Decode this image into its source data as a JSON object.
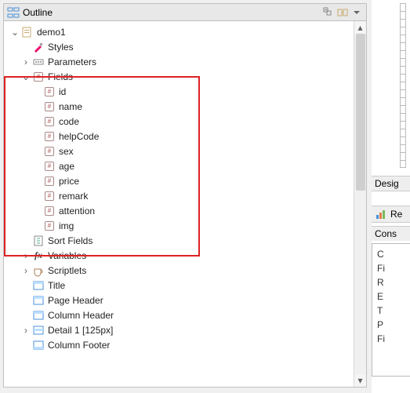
{
  "panel": {
    "title": "Outline"
  },
  "tree": {
    "root": "demo1",
    "nodes": {
      "styles": "Styles",
      "parameters": "Parameters",
      "fields": "Fields",
      "sortFields": "Sort Fields",
      "variables": "Variables",
      "scriptlets": "Scriptlets",
      "title": "Title",
      "pageHeader": "Page Header",
      "columnHeader": "Column Header",
      "detail": "Detail 1 [125px]",
      "columnFooter": "Column Footer"
    },
    "fields": {
      "0": "id",
      "1": "name",
      "2": "code",
      "3": "helpCode",
      "4": "sex",
      "5": "age",
      "6": "price",
      "7": "remark",
      "8": "attention",
      "9": "img"
    }
  },
  "right": {
    "designer": "Desig",
    "re": "Re",
    "cons": "Cons",
    "items": {
      "0": "C",
      "1": "Fi",
      "2": "R",
      "3": "E",
      "4": "T",
      "5": "P",
      "6": "Fi"
    }
  }
}
